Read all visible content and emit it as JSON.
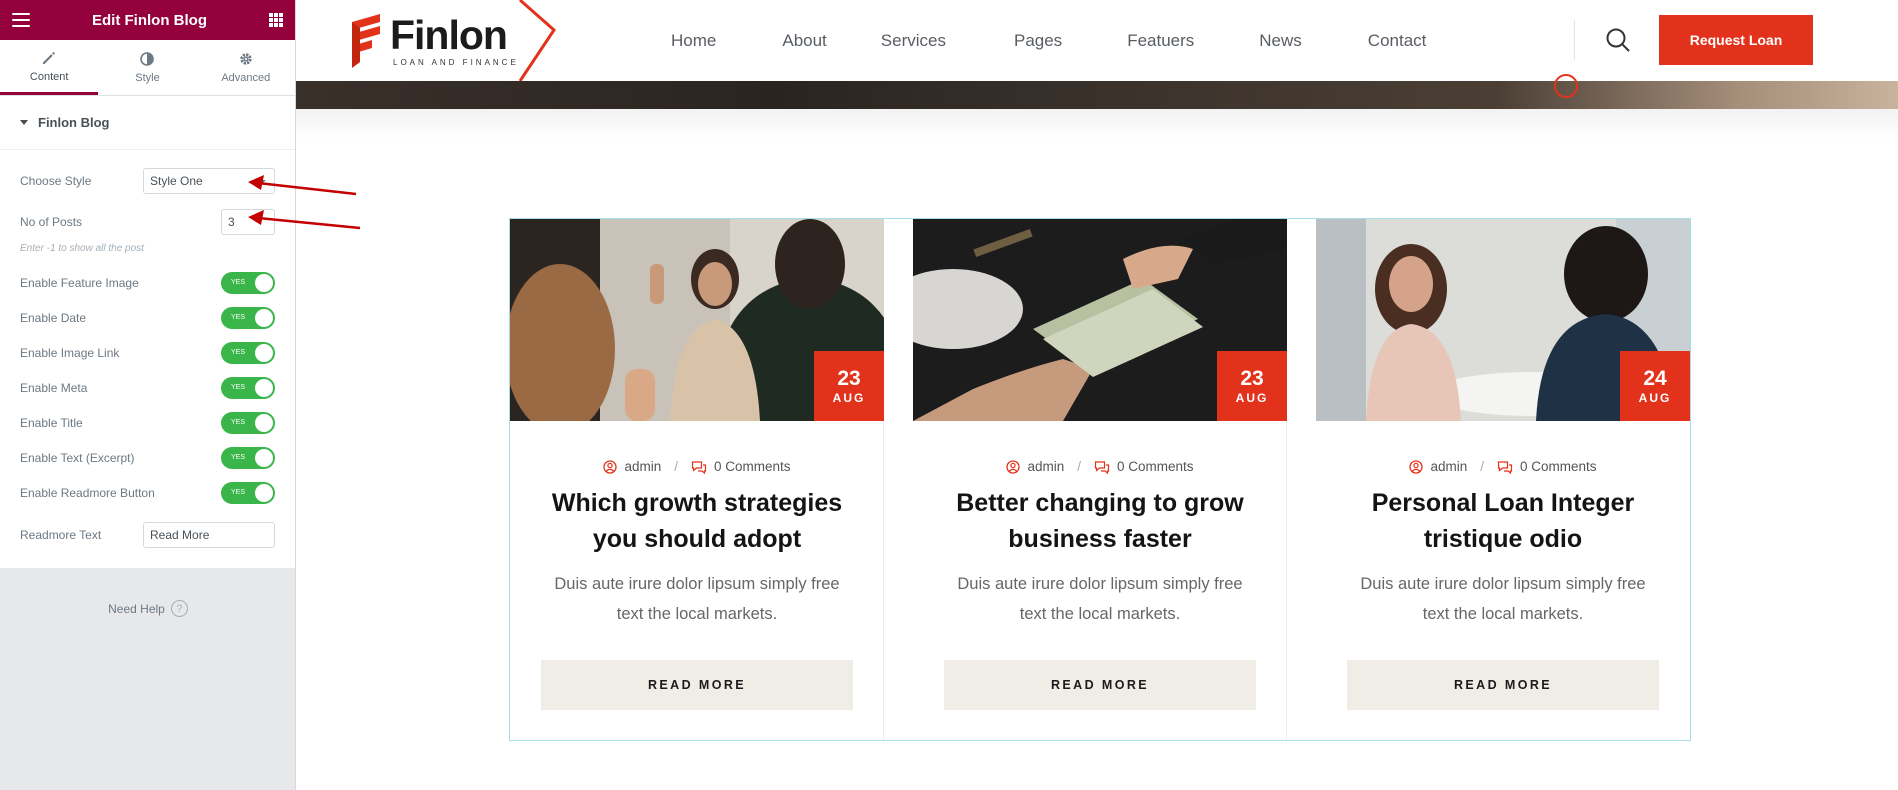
{
  "panel": {
    "title": "Edit Finlon Blog",
    "tabs": [
      {
        "label": "Content",
        "icon": "pencil-icon"
      },
      {
        "label": "Style",
        "icon": "half-circle-icon"
      },
      {
        "label": "Advanced",
        "icon": "gear-icon"
      }
    ],
    "section_title": "Finlon Blog",
    "controls": {
      "choose_style_label": "Choose Style",
      "choose_style_value": "Style One",
      "posts_label": "No of Posts",
      "posts_value": "3",
      "posts_note": "Enter -1 to show all the post",
      "toggles": [
        {
          "label": "Enable Feature Image",
          "state": "YES"
        },
        {
          "label": "Enable Date",
          "state": "YES"
        },
        {
          "label": "Enable Image Link",
          "state": "YES"
        },
        {
          "label": "Enable Meta",
          "state": "YES"
        },
        {
          "label": "Enable Title",
          "state": "YES"
        },
        {
          "label": "Enable Text (Excerpt)",
          "state": "YES"
        },
        {
          "label": "Enable Readmore Button",
          "state": "YES"
        }
      ],
      "readmore_label": "Readmore Text",
      "readmore_value": "Read More"
    },
    "help": "Need Help",
    "help_icon": "?"
  },
  "site": {
    "logo": {
      "word": "Finlon",
      "tagline": "LOAN AND FINANCE"
    },
    "nav": [
      "Home",
      "About",
      "Services",
      "Pages",
      "Featuers",
      "News",
      "Contact"
    ],
    "cta": "Request Loan",
    "brand_color": "#e3321b"
  },
  "posts": [
    {
      "day": "23",
      "month": "AUG",
      "author": "admin",
      "comments": "0 Comments",
      "title": "Which growth strategies you should adopt",
      "excerpt": "Duis aute irure dolor lipsum simply free text the local markets.",
      "button": "READ MORE"
    },
    {
      "day": "23",
      "month": "AUG",
      "author": "admin",
      "comments": "0 Comments",
      "title": "Better changing to grow business faster",
      "excerpt": "Duis aute irure dolor lipsum simply free text the local markets.",
      "button": "READ MORE"
    },
    {
      "day": "24",
      "month": "AUG",
      "author": "admin",
      "comments": "0 Comments",
      "title": "Personal Loan Integer tristique odio",
      "excerpt": "Duis aute irure dolor lipsum simply free text the local markets.",
      "button": "READ MORE"
    }
  ]
}
